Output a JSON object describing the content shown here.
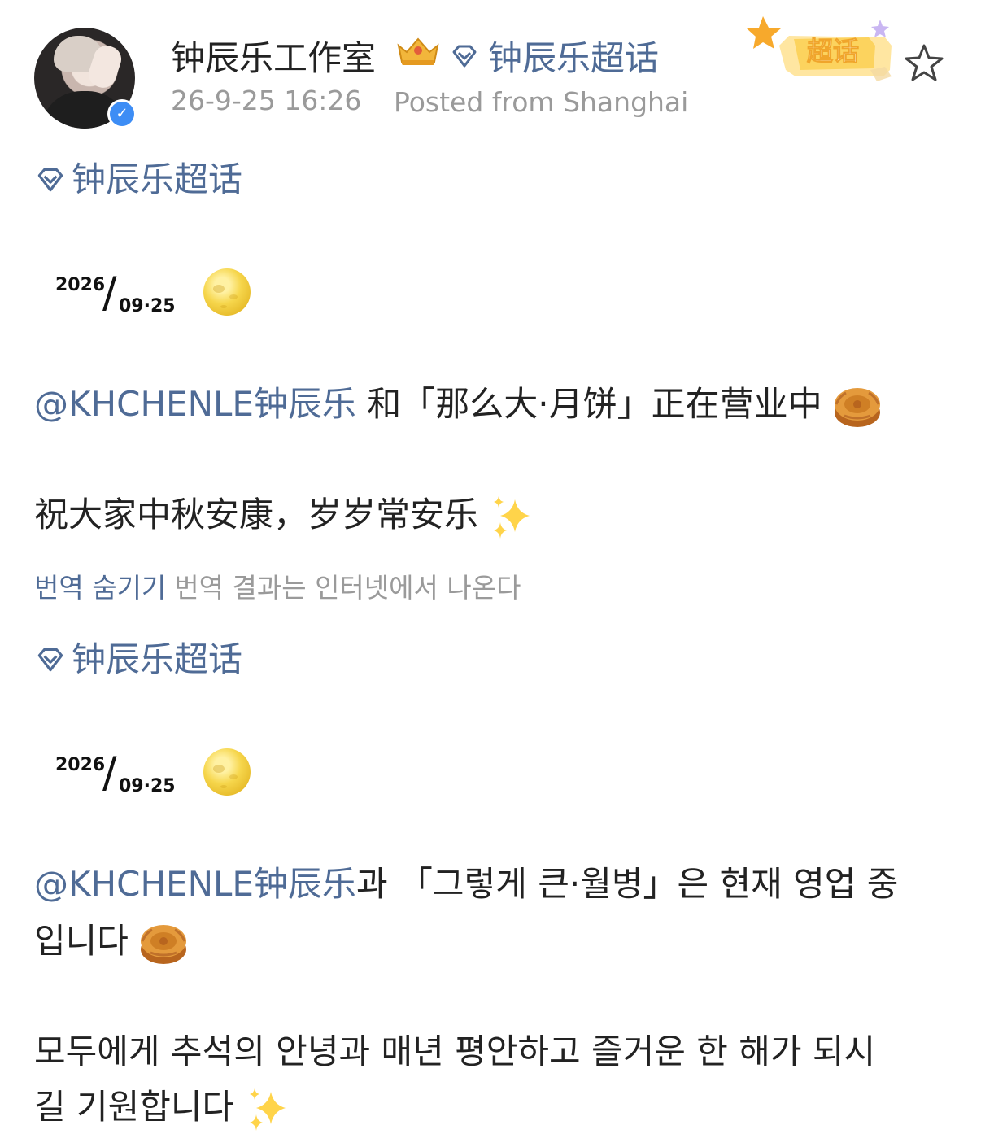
{
  "header": {
    "username": "钟辰乐工作室",
    "topic_link": "钟辰乐超话",
    "timestamp": "26-9-25 16:26",
    "location": "Posted from Shanghai",
    "supertopic_badge": "超话",
    "icons": {
      "avatar": "avatar",
      "verified": "verified-badge-icon",
      "crown": "crown-icon",
      "diamond": "diamond-icon",
      "star": "star-icon"
    }
  },
  "post": {
    "topic_tag_1": "钟辰乐超话",
    "date_year_1": "2026",
    "date_slash": "/",
    "date_day_1": "09·25",
    "mention_1": "@KHCHENLE钟辰乐",
    "line_cn_1_rest": " 和「那么大·月饼」正在营业中",
    "line_cn_2": "祝大家中秋安康，岁岁常安乐",
    "translation_hide": "번역 숨기기",
    "translation_note": "번역 결과는 인터넷에서 나온다",
    "topic_tag_2": "钟辰乐超话",
    "date_year_2": "2026",
    "date_day_2": "09·25",
    "mention_2": "@KHCHENLE钟辰乐",
    "line_kr_1_rest": "과 「그렇게 큰·월병」은 현재 영업 중",
    "line_kr_2": "입니다",
    "line_kr_3": "모두에게 추석의 안녕과 매년 평안하고 즐거운 한 해가 되시",
    "line_kr_4": "길 기원합니다"
  },
  "colors": {
    "link": "#4f6b96",
    "meta": "#9a9a9a",
    "text": "#222222",
    "verified": "#3d8df5"
  }
}
